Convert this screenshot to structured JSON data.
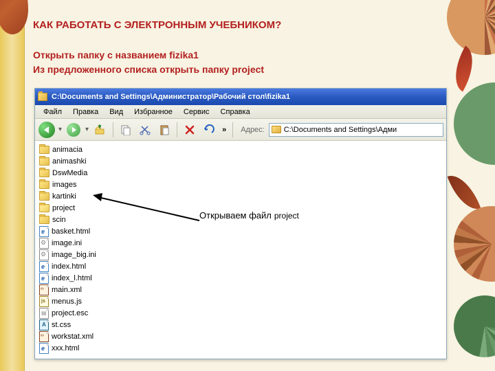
{
  "slide": {
    "heading": "КАК РАБОТАТЬ С ЭЛЕКТРОННЫМ  УЧЕБНИКОМ?",
    "instruction_line1": "Открыть  папку  с  названием fizika1",
    "instruction_line2": "Из  предложенного  списка открыть    папку project",
    "annotation_text": "Открываем файл",
    "annotation_highlight": "project"
  },
  "explorer": {
    "title": "C:\\Documents and Settings\\Администратор\\Рабочий стол\\fizika1",
    "address_label": "Адрес:",
    "address_value": "C:\\Documents and Settings\\Адми",
    "menu": [
      "Файл",
      "Правка",
      "Вид",
      "Избранное",
      "Сервис",
      "Справка"
    ],
    "overflow": "»",
    "items": [
      {
        "name": "animacia",
        "type": "folder"
      },
      {
        "name": "animashki",
        "type": "folder"
      },
      {
        "name": "DswMedia",
        "type": "folder"
      },
      {
        "name": "images",
        "type": "folder"
      },
      {
        "name": "kartinki",
        "type": "folder"
      },
      {
        "name": "project",
        "type": "folder-open"
      },
      {
        "name": "scin",
        "type": "folder"
      },
      {
        "name": "basket.html",
        "type": "html"
      },
      {
        "name": "image.ini",
        "type": "ini"
      },
      {
        "name": "image_big.ini",
        "type": "ini"
      },
      {
        "name": "index.html",
        "type": "html"
      },
      {
        "name": "index_l.html",
        "type": "html"
      },
      {
        "name": "main.xml",
        "type": "xml"
      },
      {
        "name": "menus.js",
        "type": "js"
      },
      {
        "name": "project.esc",
        "type": "generic"
      },
      {
        "name": "st.css",
        "type": "css"
      },
      {
        "name": "workstat.xml",
        "type": "xml"
      },
      {
        "name": "xxx.html",
        "type": "html"
      }
    ]
  }
}
